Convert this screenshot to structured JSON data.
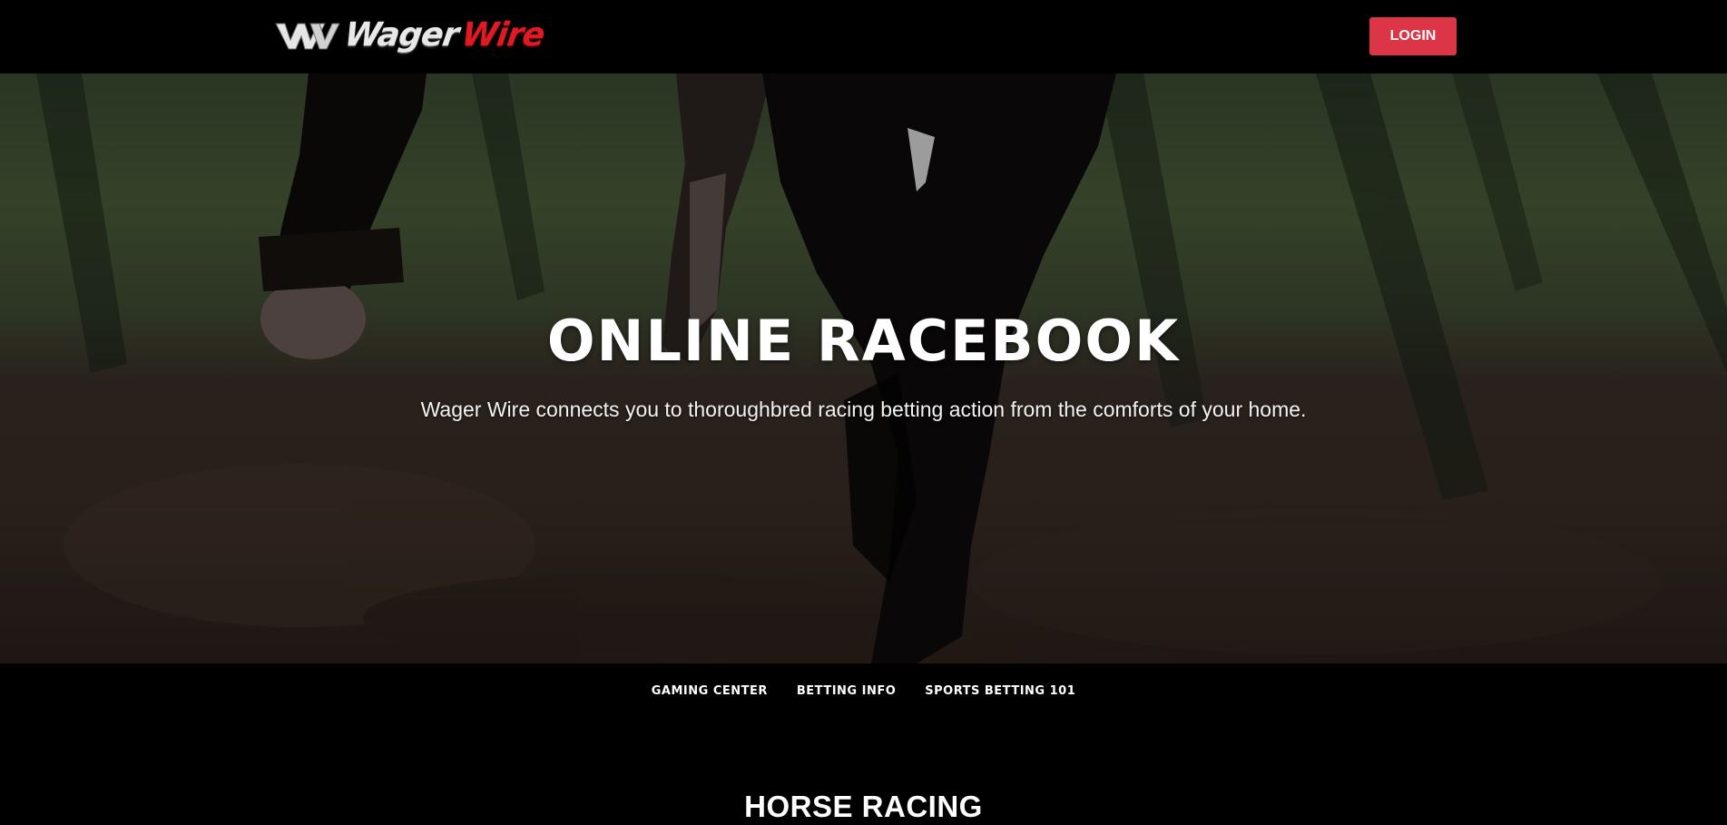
{
  "header": {
    "logo_wager": "Wager",
    "logo_wire": "Wire",
    "login_label": "LOGIN"
  },
  "hero": {
    "title": "ONLINE RACEBOOK",
    "subtitle": "Wager Wire connects you to thoroughbred racing betting action from the comforts of your home."
  },
  "subnav": {
    "items": [
      {
        "label": "GAMING CENTER"
      },
      {
        "label": "BETTING INFO"
      },
      {
        "label": "SPORTS BETTING 101"
      }
    ]
  },
  "section": {
    "title": "HORSE RACING"
  },
  "colors": {
    "accent": "#dc3545",
    "logo_red": "#e01a22",
    "background": "#000000"
  },
  "icons": {
    "logo_mark": "ww-logo-mark"
  }
}
